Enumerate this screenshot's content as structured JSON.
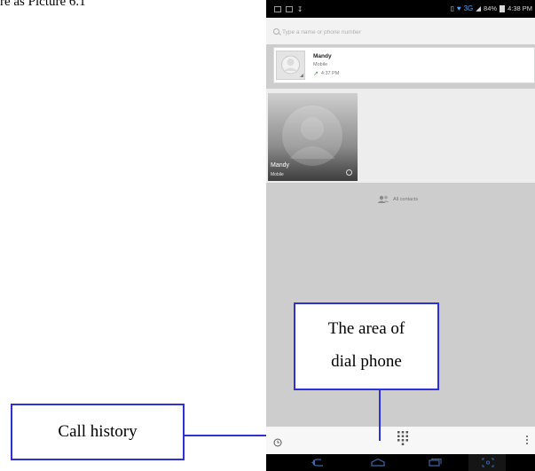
{
  "document": {
    "caption": "re as Picture 6.1"
  },
  "status_bar": {
    "network": "3G",
    "battery": "84%",
    "time": "4:38 PM"
  },
  "search": {
    "placeholder": "Type a name or phone number"
  },
  "recent_call": {
    "name": "Mandy",
    "type": "Mobile",
    "time": "4:37 PM"
  },
  "favorite": {
    "name": "Mandy",
    "type": "Mobile"
  },
  "all_contacts": {
    "label": "All contacts"
  },
  "annotations": {
    "dial_line1": "The area of",
    "dial_line2": "dial phone",
    "history": "Call history"
  },
  "icons": {
    "search": "search-icon",
    "call_history": "clock-icon",
    "dialpad": "dialpad-icon",
    "overflow": "overflow-menu-icon",
    "back": "back-icon",
    "home": "home-icon",
    "recent_apps": "recent-apps-icon",
    "screenshot": "screenshot-icon"
  },
  "colors": {
    "annotation_border": "#2f31d8",
    "status_accent": "#4aa3ff",
    "outgoing_call": "#4b9a3c"
  }
}
